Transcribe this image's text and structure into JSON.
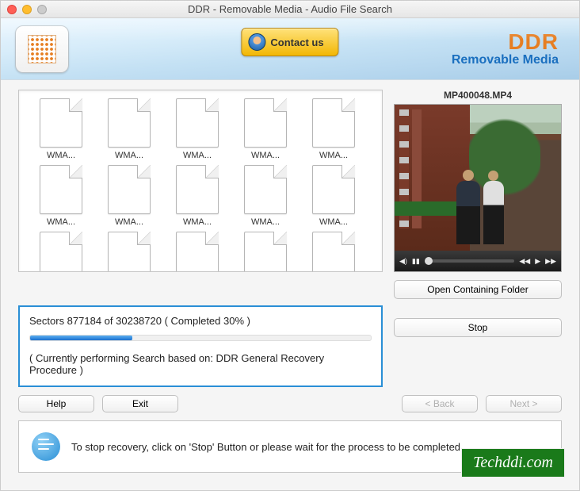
{
  "window": {
    "title": "DDR - Removable Media - Audio File Search"
  },
  "header": {
    "contact_label": "Contact us",
    "brand_title": "DDR",
    "brand_subtitle": "Removable Media"
  },
  "files": {
    "items": [
      "WMA...",
      "WMA...",
      "WMA...",
      "WMA...",
      "WMA...",
      "WMA...",
      "WMA...",
      "WMA...",
      "WMA...",
      "WMA...",
      "",
      "",
      "",
      "",
      ""
    ]
  },
  "preview": {
    "filename": "MP400048.MP4"
  },
  "buttons": {
    "open_folder": "Open Containing Folder",
    "stop": "Stop",
    "help": "Help",
    "exit": "Exit",
    "back": "< Back",
    "next": "Next >"
  },
  "progress": {
    "sectors_text": "Sectors 877184 of 30238720    ( Completed 30% )",
    "percent": 30,
    "status_text": "( Currently performing Search based on: DDR General Recovery Procedure )"
  },
  "info": {
    "text": "To stop recovery, click on 'Stop' Button or please wait for the process to be completed."
  },
  "watermark": "Techddi.com"
}
